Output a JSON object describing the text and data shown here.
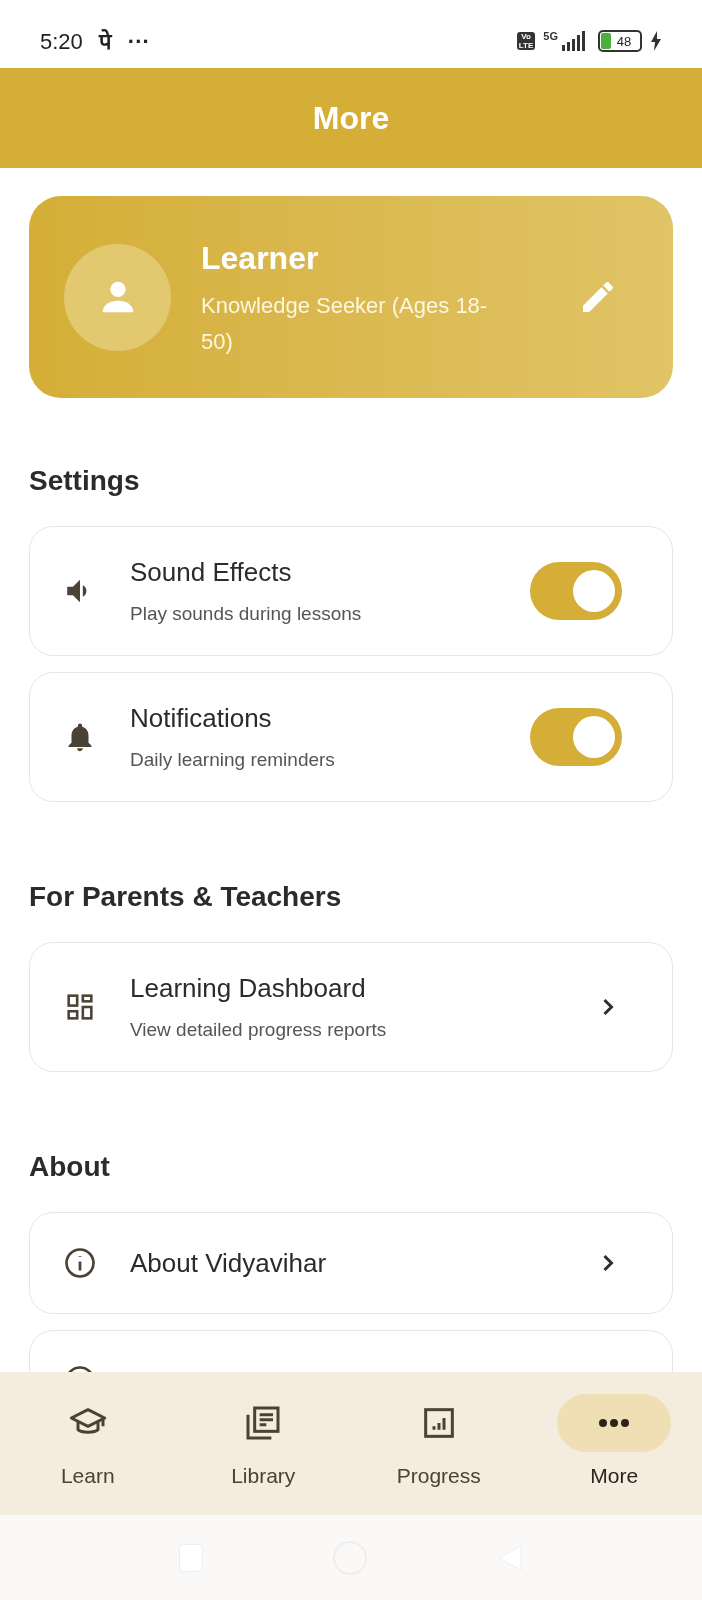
{
  "status_bar": {
    "time": "5:20",
    "app_glyph": "पे",
    "more": "···",
    "volte": [
      "Vo",
      "LTE"
    ],
    "network": "5G",
    "battery": "48"
  },
  "header": {
    "title": "More"
  },
  "profile": {
    "name": "Learner",
    "subtitle": "Knowledge Seeker (Ages 18-50)"
  },
  "sections": [
    {
      "title": "Settings",
      "items": [
        {
          "kind": "toggle",
          "title": "Sound Effects",
          "subtitle": "Play sounds during lessons",
          "on": true
        },
        {
          "kind": "toggle",
          "title": "Notifications",
          "subtitle": "Daily learning reminders",
          "on": true
        }
      ]
    },
    {
      "title": "For Parents & Teachers",
      "items": [
        {
          "kind": "link",
          "title": "Learning Dashboard",
          "subtitle": "View detailed progress reports"
        }
      ]
    },
    {
      "title": "About",
      "items": [
        {
          "kind": "link",
          "title": "About Vidyavihar"
        },
        {
          "kind": "partial"
        }
      ]
    }
  ],
  "nav": [
    {
      "label": "Learn",
      "selected": false
    },
    {
      "label": "Library",
      "selected": false
    },
    {
      "label": "Progress",
      "selected": false
    },
    {
      "label": "More",
      "selected": true
    }
  ]
}
